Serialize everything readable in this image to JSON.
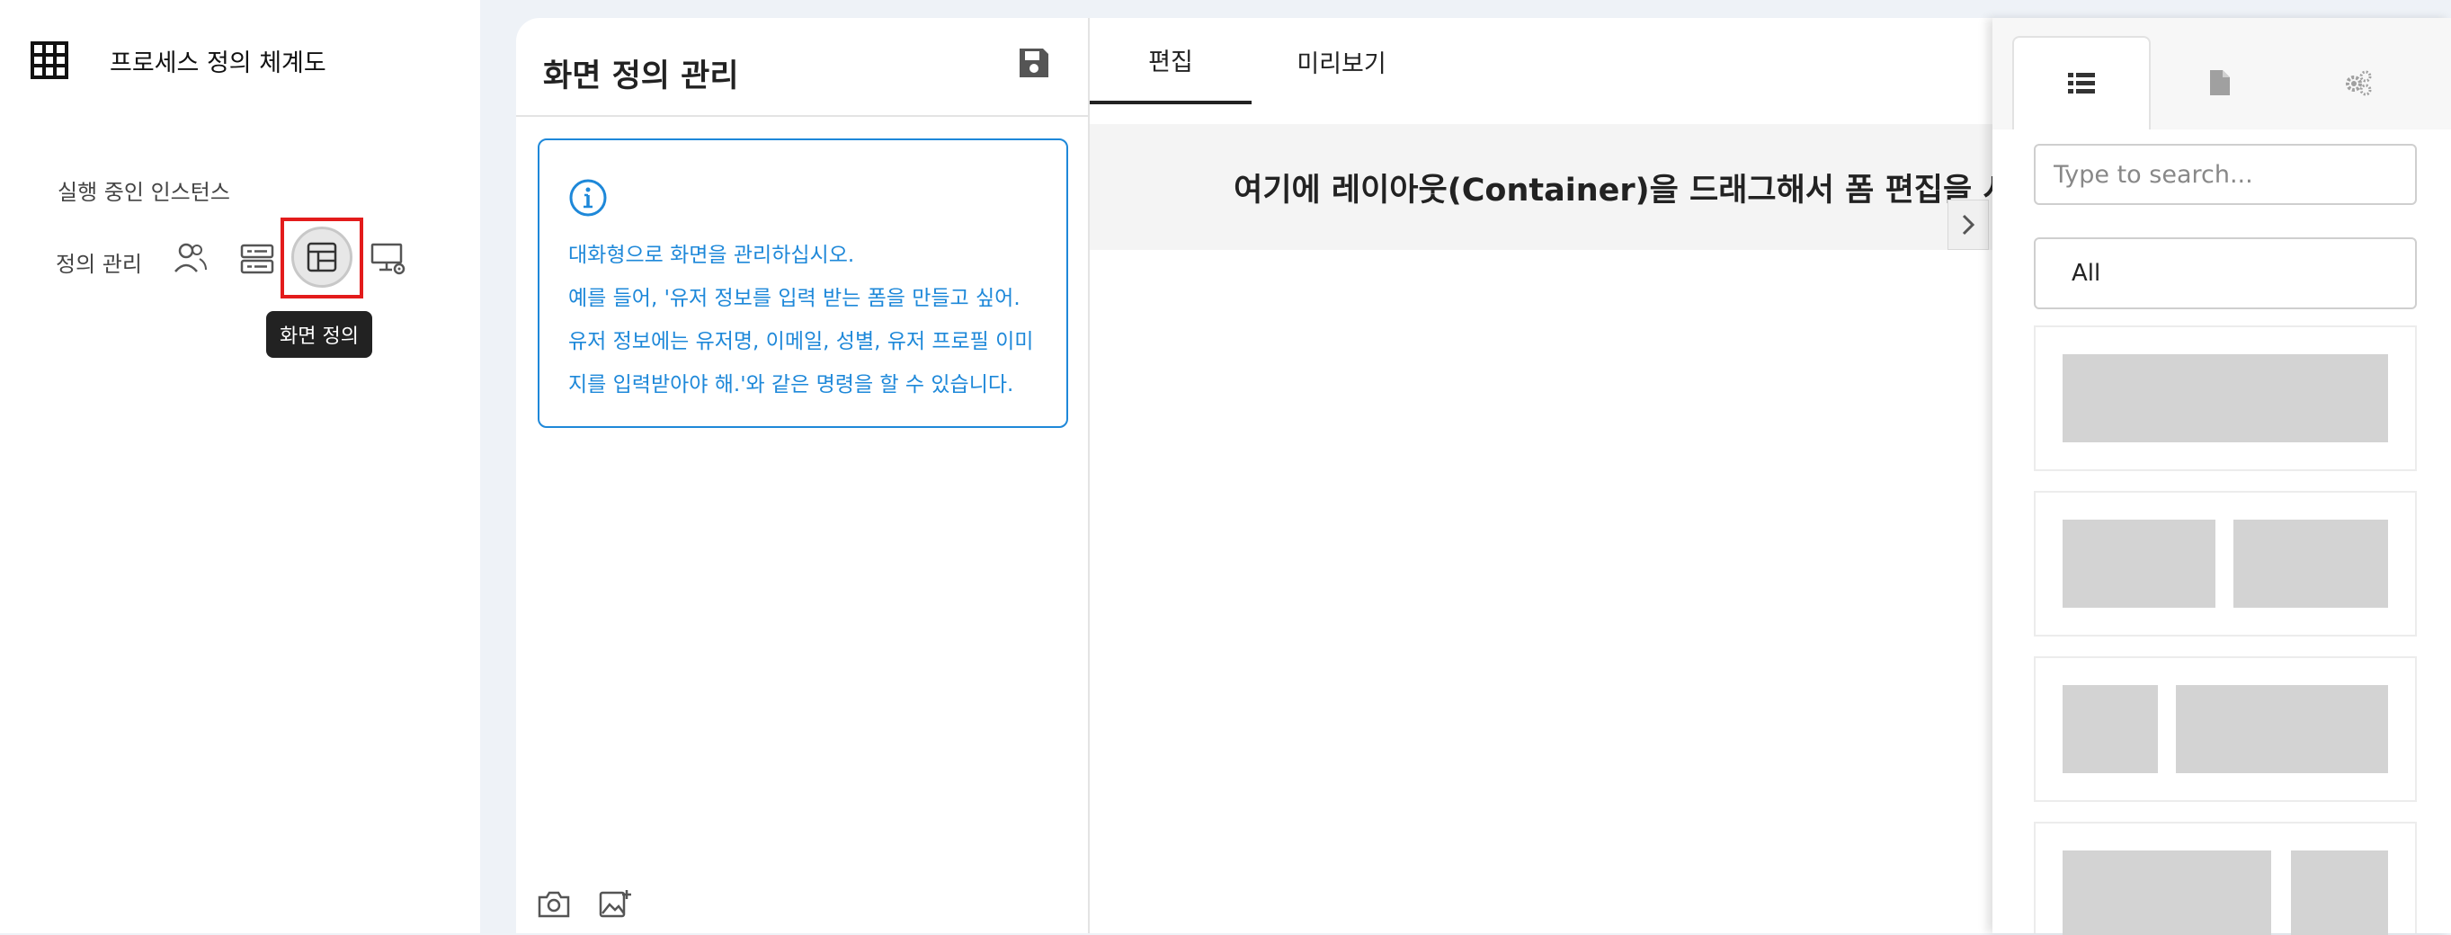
{
  "sidebar": {
    "app_title": "프로세스 정의 체계도",
    "running_label": "실행 중인 인스턴스",
    "definition_label": "정의 관리",
    "tooltip": "화면 정의",
    "icons": [
      "grid-icon",
      "users-icon",
      "list-icon",
      "screen-layout-icon",
      "desktop-settings-icon"
    ]
  },
  "left_pane": {
    "title": "화면 정의 관리",
    "info_text": "대화형으로 화면을 관리하십시오.\n예를 들어, '유저 정보를 입력 받는 폼을 만들고 싶어.\n유저 정보에는 유저명, 이메일, 성별, 유저 프로필 이미\n지를 입력받아야 해.'와 같은 명령을 할 수 있습니다.",
    "info_color": "#1e88d9"
  },
  "editor": {
    "tabs": [
      "편집",
      "미리보기"
    ],
    "active_tab": "편집",
    "drop_hint": "여기에 레이아웃(Container)을 드래그해서 폼 편집을 시작하십시오."
  },
  "right_panel": {
    "tab_icons": [
      "list-icon",
      "file-icon",
      "gears-icon"
    ],
    "search_placeholder": "Type to search...",
    "category": "All",
    "layouts": [
      "one-column",
      "two-equal-columns",
      "narrow-wide-columns",
      "wide-narrow-columns"
    ]
  },
  "colors": {
    "accent_blue": "#1e88d9",
    "highlight_red": "#e31b1b",
    "background": "#eef2f7"
  }
}
